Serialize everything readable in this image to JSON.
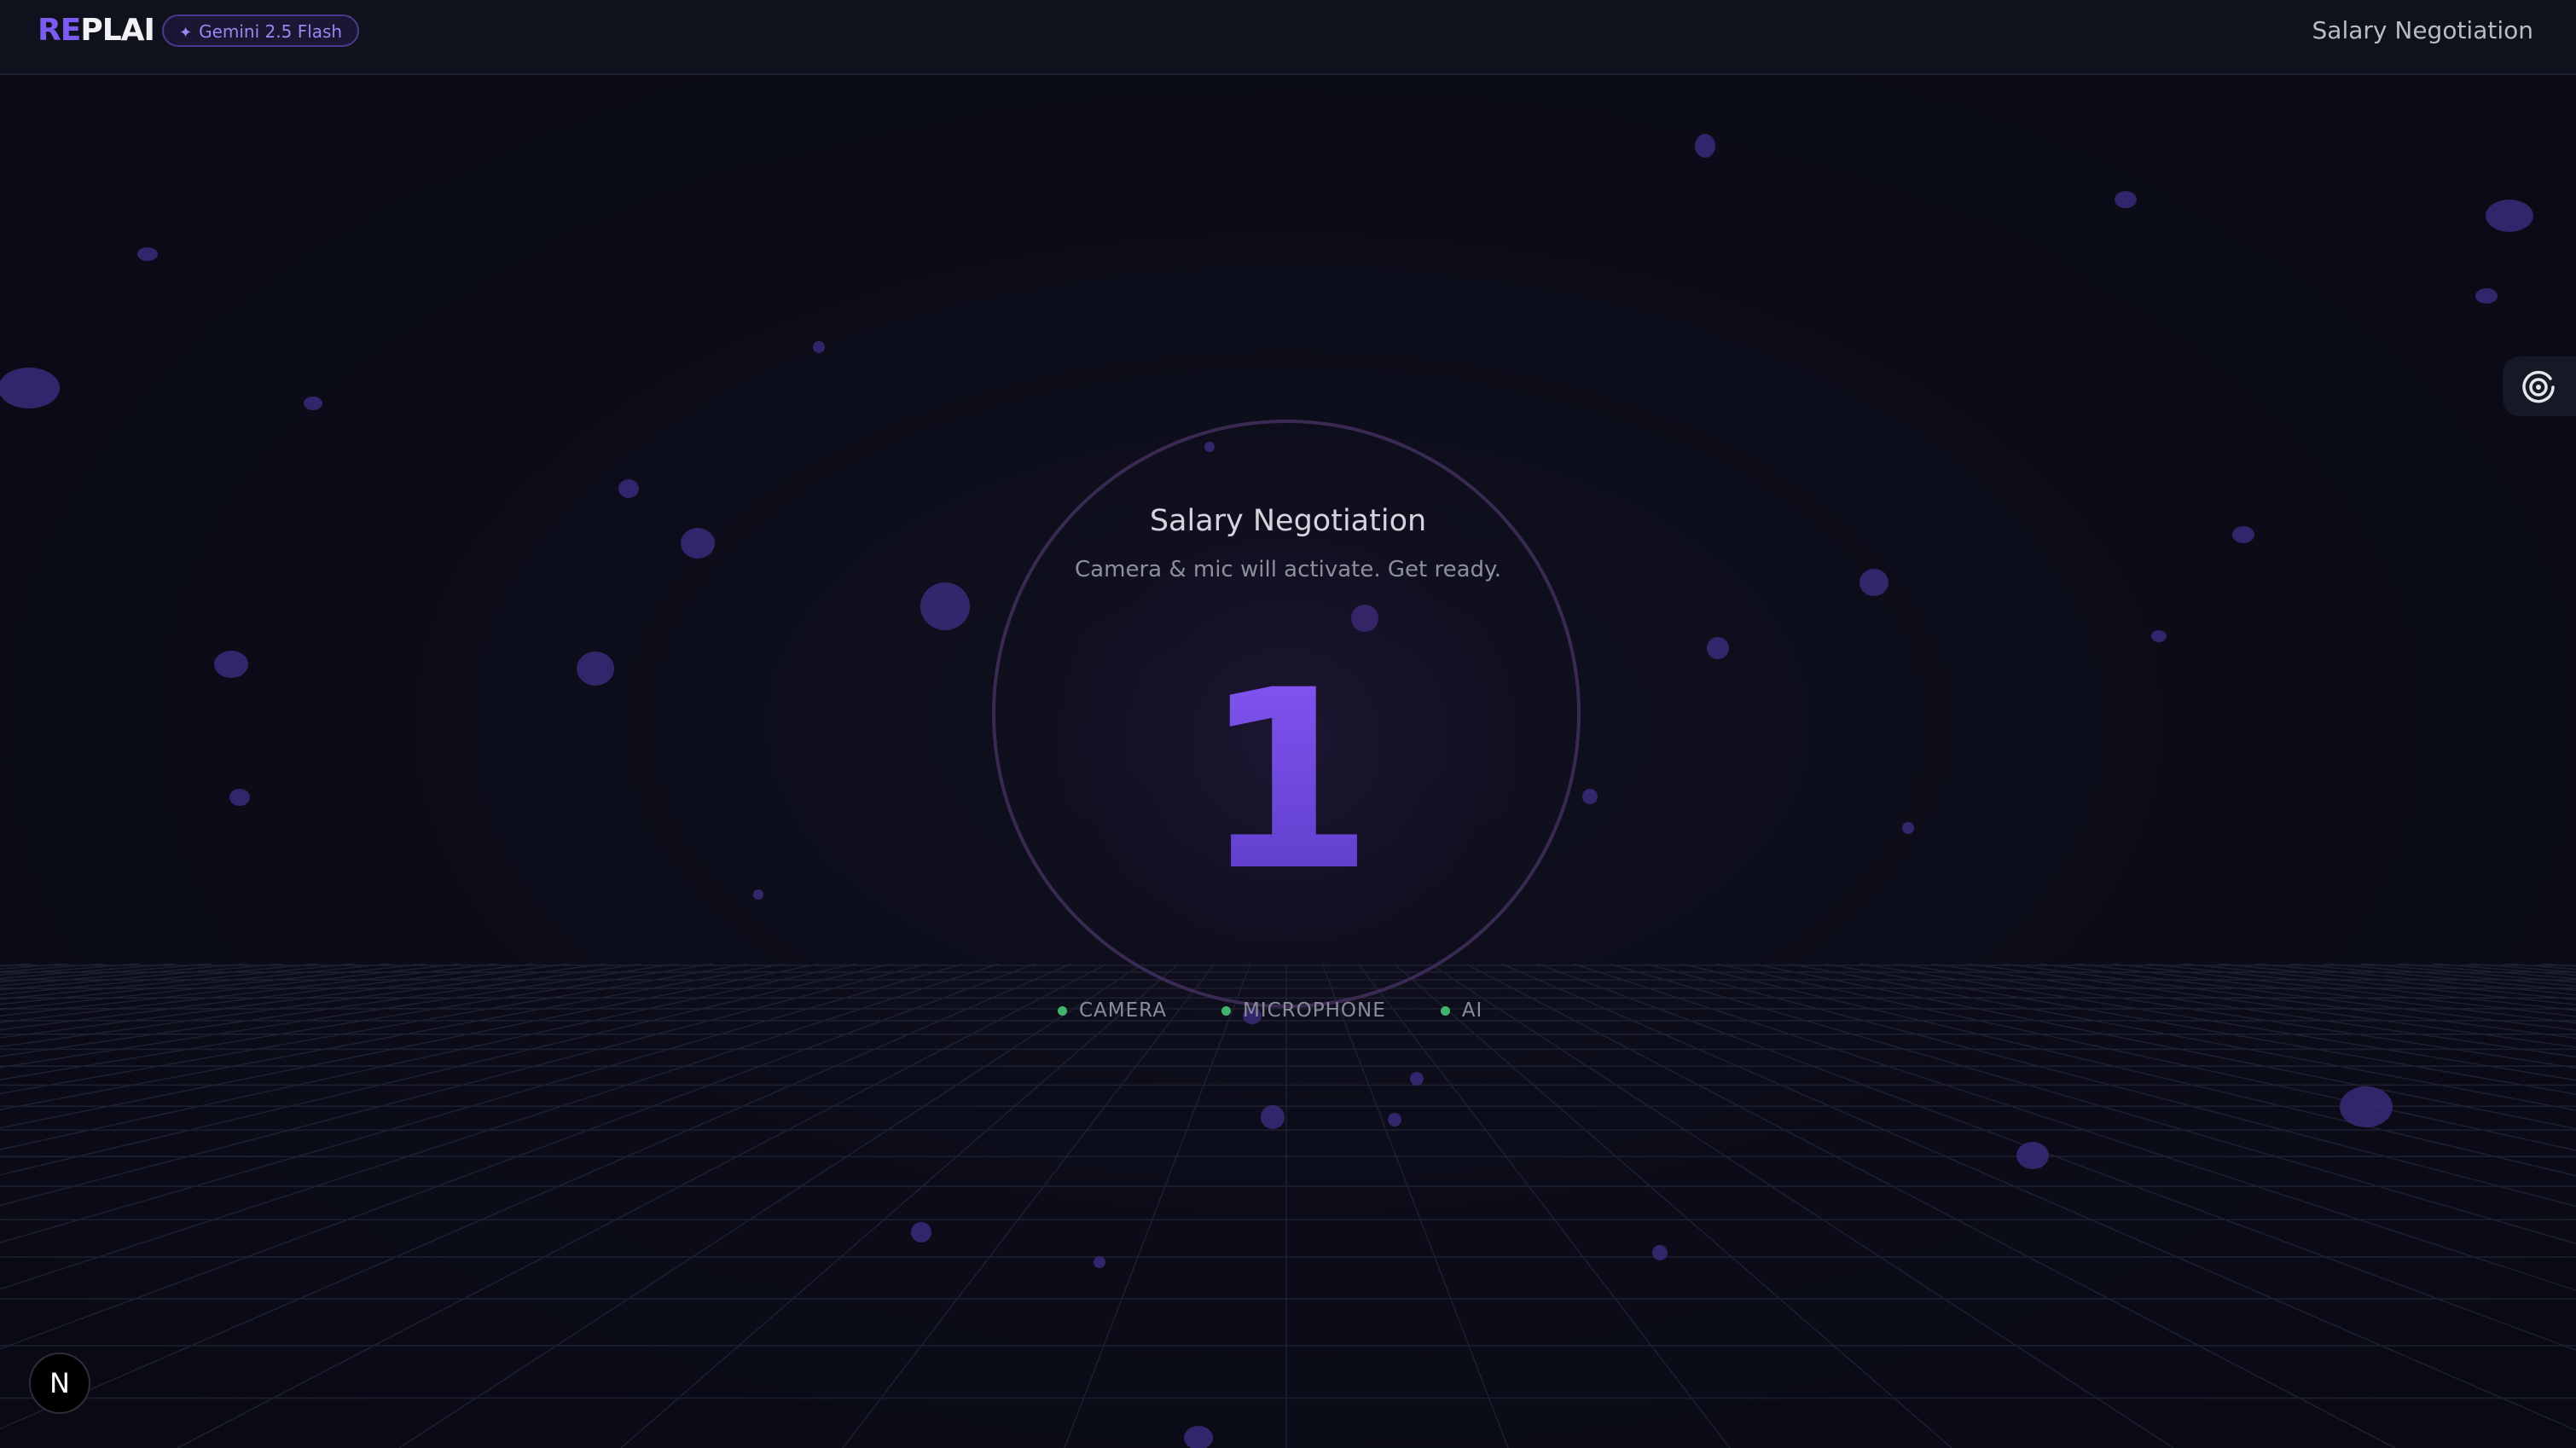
{
  "header": {
    "logo_accent": "RE",
    "logo_rest": "PLAI",
    "model_badge_icon": "sparkle-icon",
    "model_badge_label": "Gemini 2.5 Flash",
    "title": "Salary Negotiation"
  },
  "countdown": {
    "title": "Salary Negotiation",
    "subtitle": "Camera & mic will activate. Get ready.",
    "number": "1"
  },
  "status": {
    "items": [
      {
        "label": "CAMERA",
        "state": "active"
      },
      {
        "label": "MICROPHONE",
        "state": "active"
      },
      {
        "label": "AI",
        "state": "active"
      }
    ]
  },
  "side_tool": {
    "icon": "target-icon"
  },
  "corner_avatar": {
    "letter": "N"
  },
  "colors": {
    "background": "#0b0c18",
    "accent": "#7c5cf0",
    "status_active": "#3fb46a",
    "ring": "#3a2a52"
  }
}
